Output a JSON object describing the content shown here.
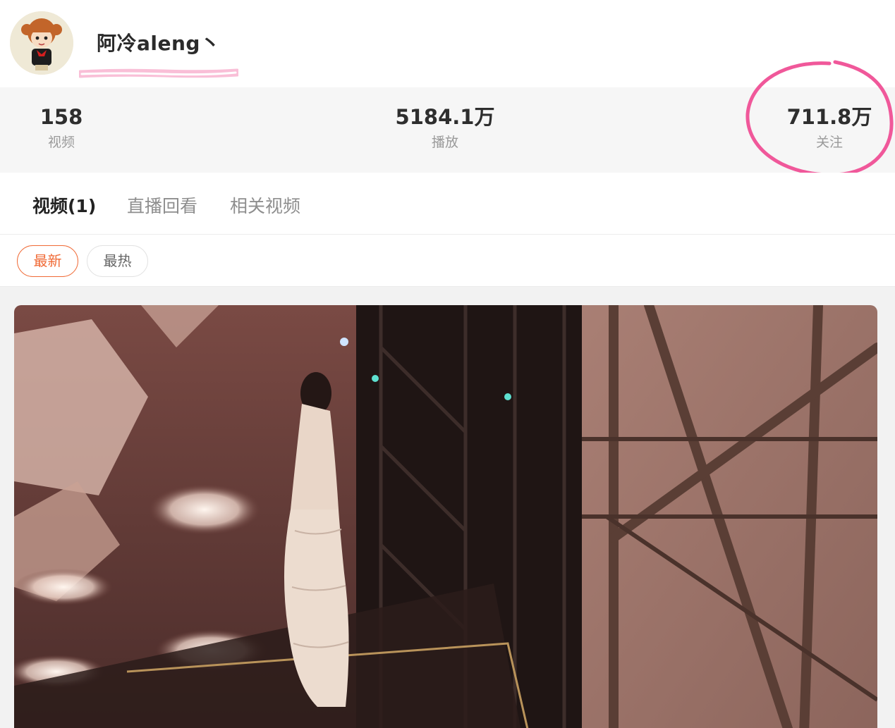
{
  "profile": {
    "username": "阿冷aleng丶"
  },
  "stats": [
    {
      "number": "158",
      "label": "视频"
    },
    {
      "number": "5184.1万",
      "label": "播放"
    },
    {
      "number": "711.8万",
      "label": "关注"
    }
  ],
  "tabs": [
    {
      "label": "视频(1)",
      "active": true
    },
    {
      "label": "直播回看",
      "active": false
    },
    {
      "label": "相关视频",
      "active": false
    }
  ],
  "filters": [
    {
      "label": "最新",
      "active": true
    },
    {
      "label": "最热",
      "active": false
    }
  ],
  "colors": {
    "accent": "#f06a36",
    "annotation": "#f0589a",
    "stats_background": "#f6f6f6"
  }
}
